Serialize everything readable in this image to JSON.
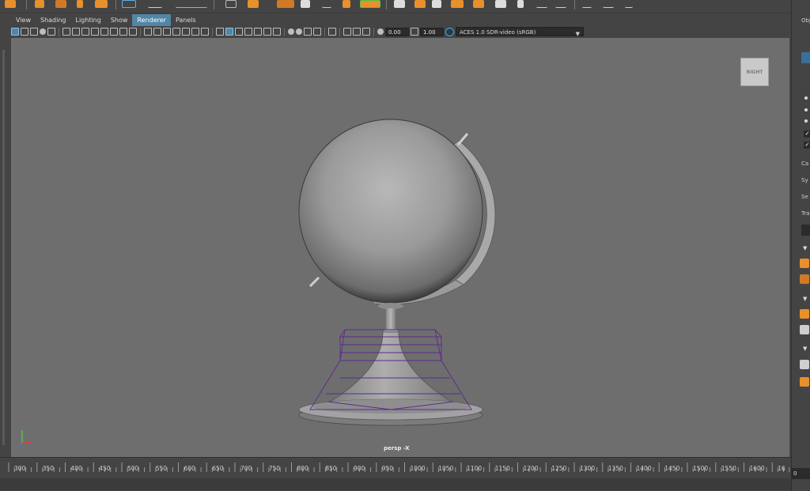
{
  "menubar": {
    "items": [
      {
        "label": "View",
        "active": false
      },
      {
        "label": "Shading",
        "active": false
      },
      {
        "label": "Lighting",
        "active": false
      },
      {
        "label": "Show",
        "active": false
      },
      {
        "label": "Renderer",
        "active": true
      },
      {
        "label": "Panels",
        "active": false
      }
    ]
  },
  "toolbar": {
    "near_clip_value": "0.00",
    "gain_value": "1.00",
    "color_management": "ACES 1.0 SDR-video (sRGB)"
  },
  "viewport": {
    "viewcube_label": "RIGHT",
    "camera_label": "persp -X",
    "colors": {
      "background": "#6e6e6e",
      "selection_wire": "#5c2a8c"
    }
  },
  "right_panel": {
    "truncated_labels": [
      "Obj",
      "Ca",
      "Sy",
      "Se",
      "Tra"
    ]
  },
  "time_slider": {
    "tick_labels": [
      "300",
      "350",
      "400",
      "450",
      "500",
      "550",
      "600",
      "650",
      "700",
      "750",
      "800",
      "850",
      "900",
      "950",
      "1000",
      "1050",
      "1100",
      "1150",
      "1200",
      "1250",
      "1300",
      "1350",
      "1400",
      "1450",
      "1500",
      "1550",
      "1600",
      "16"
    ],
    "current_frame": "0"
  },
  "icons": {
    "shelf": [
      "move-tool-icon",
      "rotate-tool-icon",
      "scale-tool-icon",
      "uv-editor-icon",
      "curve-icon",
      "polygon-icon"
    ],
    "accent_orange": "#e8902c",
    "accent_blue": "#5285a6"
  }
}
